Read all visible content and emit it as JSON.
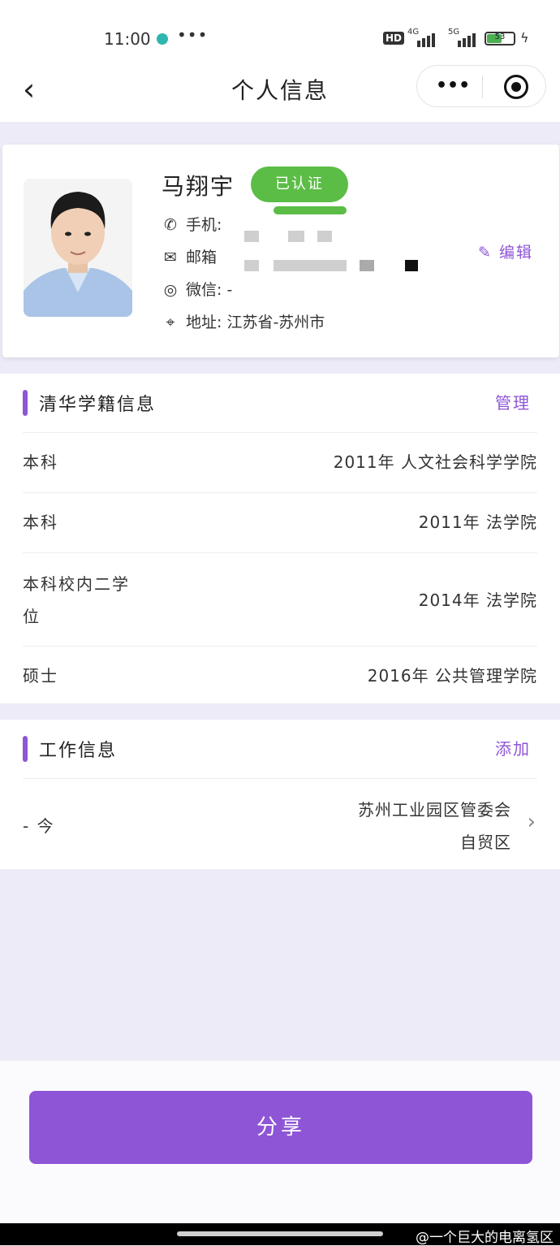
{
  "status_bar": {
    "time": "11:00",
    "more": "•••",
    "network_hd": "HD",
    "net_4g": "4G",
    "net_5g": "5G",
    "battery": "53"
  },
  "nav": {
    "title": "个人信息",
    "back_icon": "chevron-left-icon",
    "more_icon": "more-dots-icon",
    "close_icon": "target-icon"
  },
  "profile": {
    "name": "马翔宇",
    "verified_label": "已认证",
    "phone_label": "手机:",
    "email_label": "邮箱",
    "wechat_label": "微信: -",
    "address_label": "地址: 江苏省-苏州市",
    "edit_label": "编辑"
  },
  "education": {
    "title": "清华学籍信息",
    "action": "管理",
    "rows": [
      {
        "degree": "本科",
        "detail": "2011年 人文社会科学学院"
      },
      {
        "degree": "本科",
        "detail": "2011年 法学院"
      },
      {
        "degree_line1": "本科校内二学",
        "degree_line2": "位",
        "detail": "2014年 法学院"
      },
      {
        "degree": "硕士",
        "detail": "2016年 公共管理学院"
      }
    ]
  },
  "work": {
    "title": "工作信息",
    "action": "添加",
    "rows": [
      {
        "period": "- 今",
        "org_line1": "苏州工业园区管委会",
        "org_line2": "自贸区"
      }
    ]
  },
  "share_label": "分享",
  "watermark": "@一个巨大的电离氢区",
  "colors": {
    "accent": "#8e55d6",
    "verified": "#5bbd46",
    "background": "#ecebf7"
  }
}
